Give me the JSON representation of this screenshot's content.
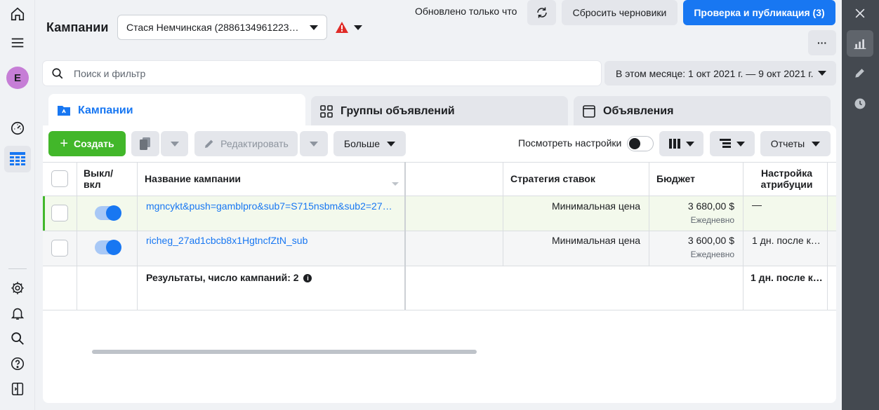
{
  "header": {
    "title": "Кампании",
    "account": "Стася Немчинская (2886134961223…",
    "updated_text": "Обновлено только что",
    "discard_label": "Сбросить черновики",
    "publish_label": "Проверка и публикация (3)",
    "more_label": "···"
  },
  "search": {
    "placeholder": "Поиск и фильтр",
    "date_range": "В этом месяце: 1 окт 2021 г. — 9 окт 2021 г."
  },
  "tabs": [
    {
      "label": "Кампании"
    },
    {
      "label": "Группы объявлений"
    },
    {
      "label": "Объявления"
    }
  ],
  "toolbar": {
    "create_label": "Создать",
    "edit_label": "Редактировать",
    "more_label": "Больше",
    "view_settings_label": "Посмотреть настройки",
    "reports_label": "Отчеты"
  },
  "table": {
    "columns": {
      "onoff": "Выкл/ вкл",
      "name": "Название кампании",
      "strategy": "Стратегия ставок",
      "budget": "Бюджет",
      "attribution": "Настройка атрибуции"
    },
    "rows": [
      {
        "name": "mgncykt&push=gamblpro&sub7=S715nsbm&sub2=27…",
        "strategy": "Минимальная цена",
        "budget": "3 680,00 $",
        "budget_period": "Ежедневно",
        "attribution": "—"
      },
      {
        "name": "richeg_27ad1cbcb8x1HgtncfZtN_sub",
        "strategy": "Минимальная цена",
        "budget": "3 600,00 $",
        "budget_period": "Ежедневно",
        "attribution": "1 дн. после к…"
      }
    ],
    "results_label": "Результаты, число кампаний: 2",
    "results_attribution": "1 дн. после к…"
  },
  "colors": {
    "accent": "#1877f2",
    "create": "#42b72a",
    "warning": "#e02b27"
  }
}
